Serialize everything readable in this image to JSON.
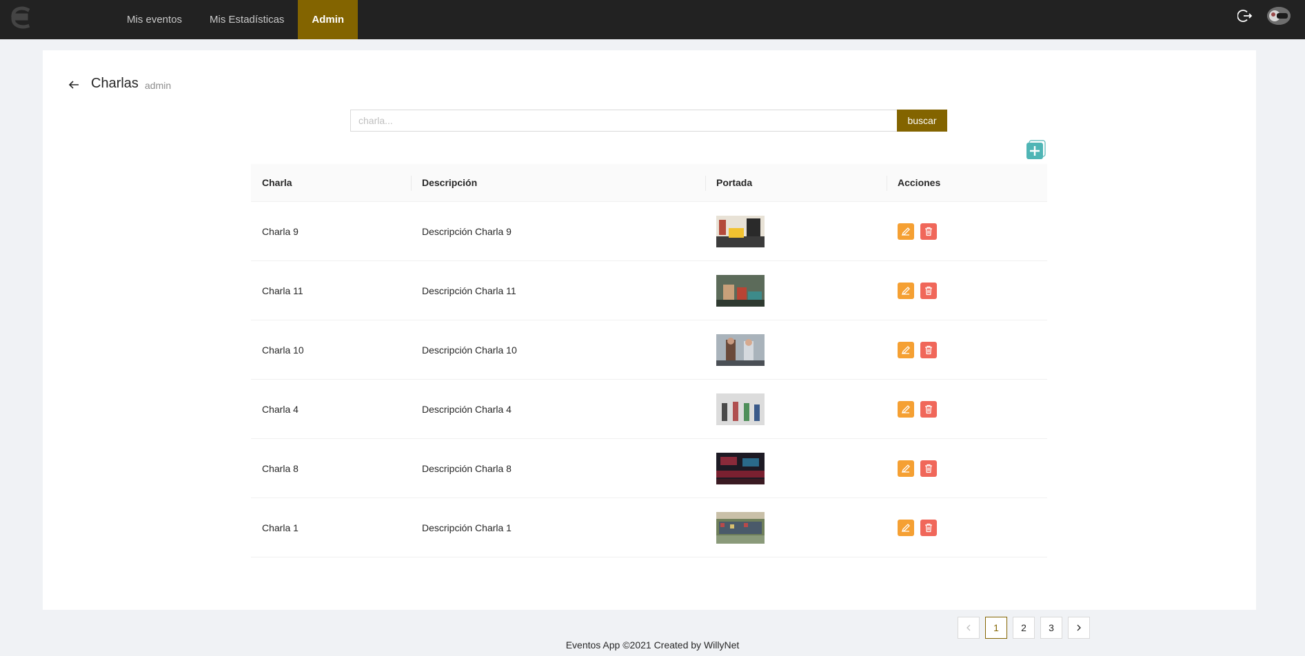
{
  "nav": {
    "items": [
      {
        "label": "Mis eventos"
      },
      {
        "label": "Mis Estadísticas"
      },
      {
        "label": "Admin"
      }
    ],
    "active_label": "Admin",
    "active_color": "#836400"
  },
  "header": {
    "title": "Charlas",
    "subtitle": "admin"
  },
  "search": {
    "placeholder": "charla...",
    "value": "",
    "button_label": "buscar"
  },
  "table": {
    "columns": [
      "Charla",
      "Descripción",
      "Portada",
      "Acciones"
    ],
    "rows": [
      {
        "charla": "Charla 9",
        "descripcion": "Descripción Charla 9"
      },
      {
        "charla": "Charla 11",
        "descripcion": "Descripción Charla 11"
      },
      {
        "charla": "Charla 10",
        "descripcion": "Descripción Charla 10"
      },
      {
        "charla": "Charla 4",
        "descripcion": "Descripción Charla 4"
      },
      {
        "charla": "Charla 8",
        "descripcion": "Descripción Charla 8"
      },
      {
        "charla": "Charla 1",
        "descripcion": "Descripción Charla 1"
      }
    ]
  },
  "pagination": {
    "pages": [
      "1",
      "2",
      "3"
    ],
    "current": "1"
  },
  "footer": {
    "text": "Eventos App ©2021 Created by WillyNet"
  },
  "colors": {
    "topbar": "#222222",
    "accent": "#836400",
    "edit": "#f5a033",
    "delete": "#f0675a",
    "add": "#4fb5b5"
  },
  "icons": {
    "logo": "eventos-logo-icon",
    "logout": "logout-icon",
    "back": "arrow-left-icon",
    "add": "plus-icon",
    "edit": "pencil-icon",
    "delete": "trash-icon",
    "prev": "chevron-left-icon",
    "next": "chevron-right-icon"
  }
}
